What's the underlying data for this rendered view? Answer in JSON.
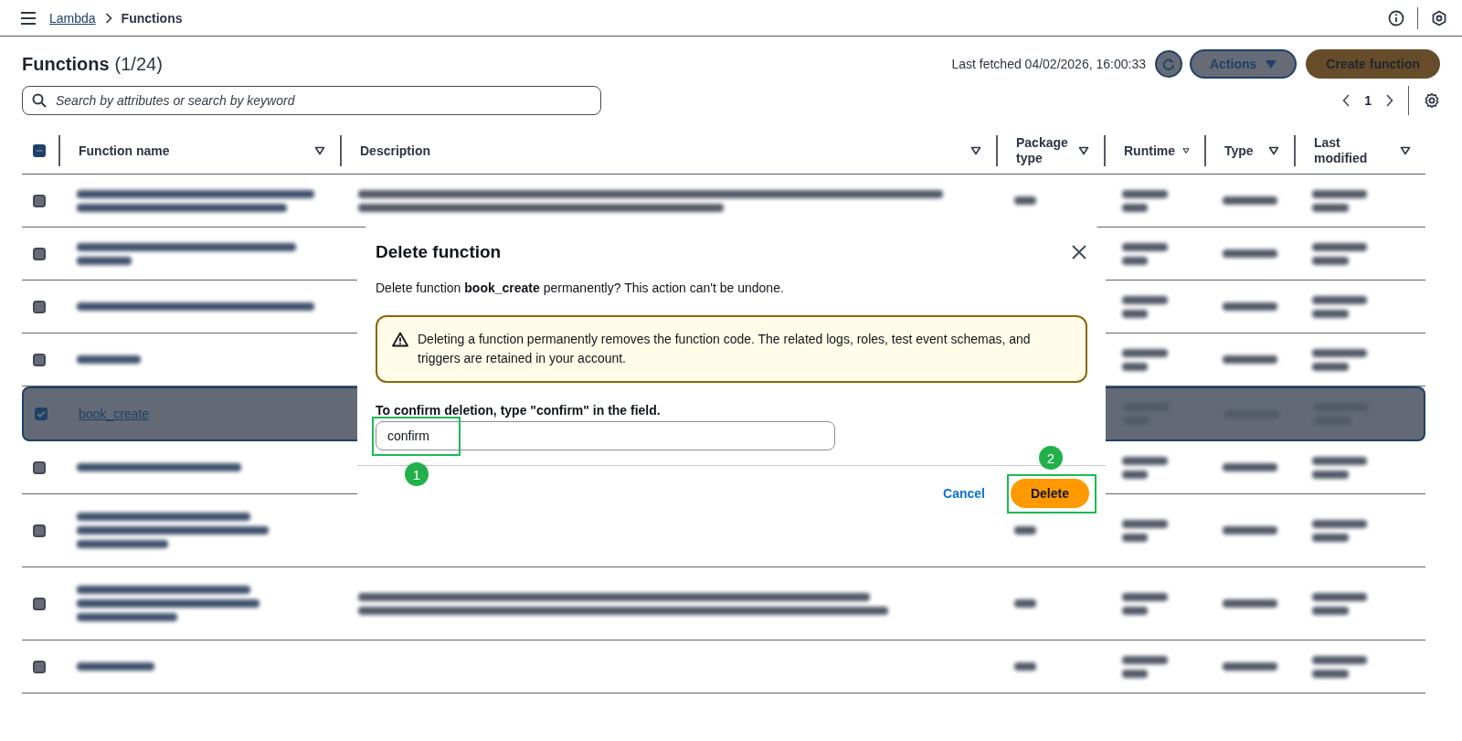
{
  "breadcrumb": [
    {
      "label": "Lambda",
      "kind": "link"
    },
    {
      "label": "Functions",
      "kind": "current"
    }
  ],
  "page": {
    "title": "Functions",
    "count": "(1/24)",
    "last_fetched": "Last fetched 04/02/2026, 16:00:33",
    "actions_button": "Actions",
    "create_button": "Create function",
    "search": {
      "placeholder": "Search by attributes or search by keyword"
    },
    "pagination": {
      "page": "1"
    }
  },
  "table": {
    "select_all_indeterminate": true,
    "columns": [
      {
        "label": "Function name"
      },
      {
        "label": "Description"
      },
      {
        "label": "Package type"
      },
      {
        "label": "Runtime"
      },
      {
        "label": "Type"
      },
      {
        "label": "Last modified"
      }
    ],
    "rows": [
      {
        "kind": "blurred",
        "selected": false
      },
      {
        "kind": "blurred",
        "selected": false
      },
      {
        "kind": "blurred",
        "selected": false
      },
      {
        "kind": "blurred",
        "selected": false
      },
      {
        "kind": "named",
        "selected": true,
        "name": "book_create"
      },
      {
        "kind": "blurred",
        "selected": false
      },
      {
        "kind": "blurred",
        "selected": false
      },
      {
        "kind": "blurred",
        "selected": false
      },
      {
        "kind": "blurred",
        "selected": false
      }
    ]
  },
  "dialog": {
    "title": "Delete function",
    "message": "Delete function **book_create** permanently? This action can't be undone.",
    "warning": "Deleting a function permanently removes the function code. The related logs, roles, test event schemas, and triggers are retained in your account.",
    "confirm_label": "To confirm deletion, type \"confirm\" in the field.",
    "confirm_value": "confirm",
    "cancel_button": "Cancel",
    "delete_button": "Delete",
    "annotations": [
      {
        "label": "1",
        "kind": "field"
      },
      {
        "label": "2",
        "kind": "button"
      }
    ]
  }
}
